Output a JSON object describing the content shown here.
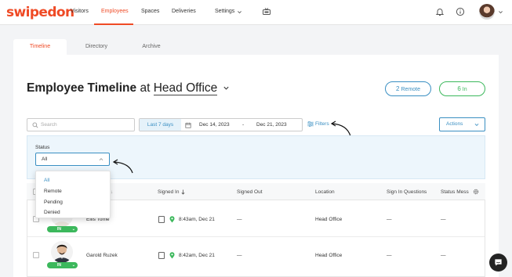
{
  "brand": {
    "logo": "swipedon",
    "accent": "#ef4a25",
    "link": "#3a8fc2",
    "success": "#3cb85c"
  },
  "nav": {
    "items": [
      "Visitors",
      "Employees",
      "Spaces",
      "Deliveries",
      "Settings"
    ],
    "active": "Employees",
    "icons": [
      "tv-icon",
      "bell-icon",
      "info-icon",
      "avatar",
      "chevron-down-icon"
    ]
  },
  "tabs": {
    "items": [
      "Timeline",
      "Directory",
      "Archive"
    ],
    "active": "Timeline"
  },
  "header": {
    "title": "Employee Timeline",
    "at": "at",
    "location": "Head Office",
    "remote_count": "2",
    "remote_label": "Remote",
    "in_count": "6",
    "in_label": "In"
  },
  "toolbar": {
    "search_placeholder": "Search",
    "quick_range": "Last 7 days",
    "start_date": "Dec 14, 2023",
    "date_sep": "-",
    "end_date": "Dec 21, 2023",
    "filters_label": "Filters",
    "actions_label": "Actions"
  },
  "filter": {
    "status_label": "Status",
    "status_value": "All",
    "options": [
      "All",
      "Remote",
      "Pending",
      "Denied"
    ]
  },
  "table": {
    "columns": [
      "Signed In",
      "Signed Out",
      "Location",
      "Sign In Questions",
      "Status Mess"
    ],
    "rows": [
      {
        "name": "Ellis Tome",
        "signed_in": "8:43am, Dec 21",
        "signed_out": "—",
        "location": "Head Office",
        "questions": "—",
        "status": "—",
        "badge": "IN"
      },
      {
        "name": "Garold Ruzek",
        "signed_in": "8:42am, Dec 21",
        "signed_out": "—",
        "location": "Head Office",
        "questions": "—",
        "status": "—",
        "badge": "IN"
      }
    ]
  }
}
